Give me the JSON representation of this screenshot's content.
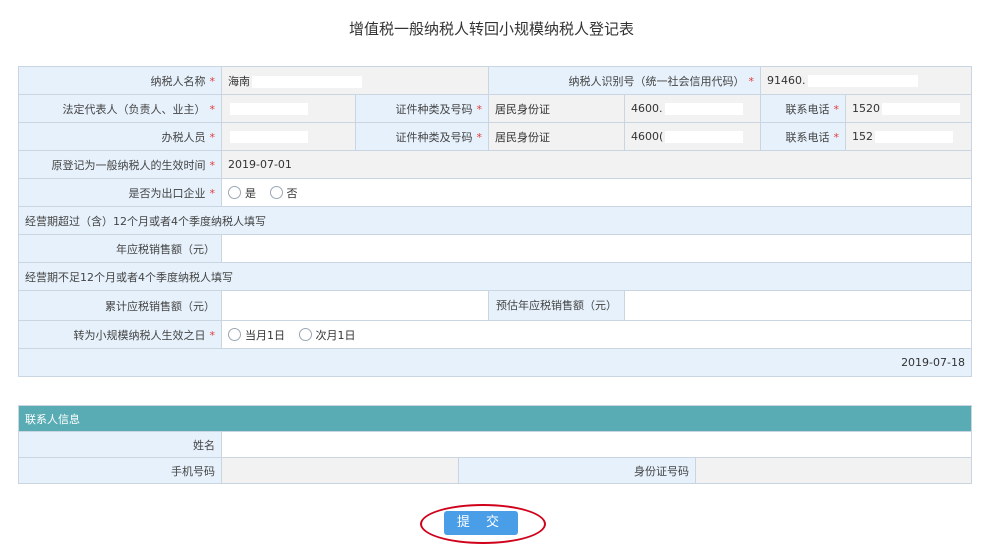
{
  "page_title": "增值税一般纳税人转回小规模纳税人登记表",
  "required_mark": "*",
  "form": {
    "taxpayer_name_label": "纳税人名称",
    "taxpayer_name_value": "海南",
    "taxpayer_id_label": "纳税人识别号（统一社会信用代码）",
    "taxpayer_id_value": "91460.",
    "legal_rep_label": "法定代表人（负责人、业主）",
    "legal_rep_value": "",
    "legal_id_type_label": "证件种类及号码",
    "legal_id_type_value": "居民身份证",
    "legal_id_number_value": "4600.",
    "legal_phone_label": "联系电话",
    "legal_phone_value": "1520",
    "tax_officer_label": "办税人员",
    "tax_officer_value": "",
    "officer_id_type_label": "证件种类及号码",
    "officer_id_type_value": "居民身份证",
    "officer_id_number_value": "4600(",
    "officer_phone_label": "联系电话",
    "officer_phone_value": "152",
    "orig_effective_label": "原登记为一般纳税人的生效时间",
    "orig_effective_value": "2019-07-01",
    "export_label": "是否为出口企业",
    "export_options": [
      "是",
      "否"
    ],
    "section_over12": "经营期超过（含）12个月或者4个季度纳税人填写",
    "annual_sales_label": "年应税销售额（元）",
    "annual_sales_value": "",
    "section_under12": "经营期不足12个月或者4个季度纳税人填写",
    "cumulative_sales_label": "累计应税销售额（元）",
    "cumulative_sales_value": "",
    "estimated_sales_label": "预估年应税销售额（元）",
    "estimated_sales_value": "",
    "effective_date_label": "转为小规模纳税人生效之日",
    "effective_date_options": [
      "当月1日",
      "次月1日"
    ],
    "fill_date": "2019-07-18"
  },
  "contact": {
    "header": "联系人信息",
    "name_label": "姓名",
    "name_value": "",
    "phone_label": "手机号码",
    "phone_value": "",
    "id_label": "身份证号码",
    "id_value": ""
  },
  "submit_label": "提 交",
  "colors": {
    "label_bg": "#e6f1fb",
    "readonly_bg": "#f2f2f2",
    "contact_header_bg": "#5aacb4",
    "submit_bg": "#4a9ee8",
    "highlight_ring": "#d0021b",
    "required": "#e23b3b"
  }
}
